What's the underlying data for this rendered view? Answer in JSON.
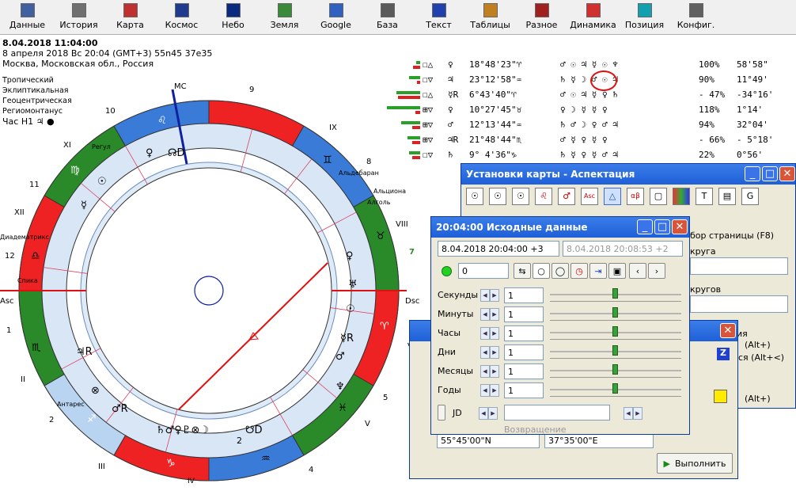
{
  "toolbar": [
    {
      "name": "data",
      "label": "Данные",
      "color": "#4060a0"
    },
    {
      "name": "history",
      "label": "История",
      "color": "#707070"
    },
    {
      "name": "map",
      "label": "Карта",
      "color": "#c03030"
    },
    {
      "name": "cosmos",
      "label": "Космос",
      "color": "#203a90"
    },
    {
      "name": "sky",
      "label": "Небо",
      "color": "#0a2a80"
    },
    {
      "name": "earth",
      "label": "Земля",
      "color": "#3a8a3a"
    },
    {
      "name": "google",
      "label": "Google",
      "color": "#3060c0"
    },
    {
      "name": "base",
      "label": "База",
      "color": "#5a5a5a"
    },
    {
      "name": "text",
      "label": "Текст",
      "color": "#2040b0"
    },
    {
      "name": "tables",
      "label": "Таблицы",
      "color": "#c08020"
    },
    {
      "name": "misc",
      "label": "Разное",
      "color": "#a02020"
    },
    {
      "name": "dynamics",
      "label": "Динамика",
      "color": "#d03030"
    },
    {
      "name": "position",
      "label": "Позиция",
      "color": "#10a0b0"
    },
    {
      "name": "config",
      "label": "Конфиг.",
      "color": "#606060"
    }
  ],
  "info": {
    "datetime": "8.04.2018 11:04:00",
    "line2": "8 апреля 2018  Вс  20:04 (GMT+3) 55n45  37e35",
    "location": "Москва, Московская обл., Россия"
  },
  "system": [
    "Тропический",
    "Эклиптикальная",
    "Геоцентрическая",
    "Региомонтанус"
  ],
  "hour": "Час Н1  ♃ ●",
  "chart": {
    "axis": {
      "mc": "MC",
      "asc": "Asc",
      "dsc": "Dsc"
    },
    "houses": [
      "1",
      "2",
      "3",
      "4",
      "5",
      "6",
      "7",
      "8",
      "9",
      "10",
      "11",
      "12"
    ],
    "houses_roman": [
      "II",
      "III",
      "IV",
      "V",
      "VI",
      "VIII",
      "IX",
      "XI",
      "XII"
    ],
    "stars": [
      "Регул",
      "Альдебаран",
      "Альциона",
      "Алголь",
      "Диадематрикс",
      "Спика",
      "Антарес"
    ],
    "signs": [
      "♌",
      "♊",
      "♉",
      "♈",
      "♓",
      "♒",
      "♑",
      "♐",
      "♏",
      "♎",
      "♍"
    ],
    "planets": [
      "♀",
      "☊D",
      "☉",
      "☿",
      "♀",
      "♅",
      "☉",
      "☿R",
      "♂",
      "♆",
      "♃R",
      "⊗",
      "♂R",
      "♄♂♀♇⊗☽",
      "☋D",
      "2"
    ]
  },
  "aspects": [
    {
      "a": "☐△",
      "p": "♀",
      "pos": "18°48'23\"♈",
      "c": "♂ ☉ ♃ ☿ ☉ ♆",
      "pct": "100%",
      "orb": "58'58\""
    },
    {
      "a": "☐▽",
      "p": "♃",
      "pos": "23°12'58\"♒",
      "c": "♄ ☿ ☽ ♂ ☉ ♃",
      "pct": "90%",
      "orb": "11°49'"
    },
    {
      "a": "☐△",
      "p": "☿R",
      "pos": "6°43'40\"♈",
      "c": "♂ ☉ ♃ ☿ ♀ ♄",
      "pct": "- 47%",
      "orb": "-34°16'"
    },
    {
      "a": "⊞▽",
      "p": "♀",
      "pos": "10°27'45\"♉",
      "c": "♀ ☽ ☿ ☿ ♀",
      "pct": "118%",
      "orb": "1°14'"
    },
    {
      "a": "⊞▽",
      "p": "♂",
      "pos": "12°13'44\"♒",
      "c": "♄ ♂ ☽ ♀ ♂ ♃",
      "pct": "94%",
      "orb": "32°04'"
    },
    {
      "a": "⊞▽",
      "p": "♃R",
      "pos": "21°48'44\"♏",
      "c": "♂ ☿ ♀ ☿ ♀",
      "pct": "- 66%",
      "orb": "- 5°18'"
    },
    {
      "a": "☐▽",
      "p": "♄",
      "pos": "9° 4'36\"♑",
      "c": "♄ ☿ ♀ ☿ ♂ ♃",
      "pct": "22%",
      "orb": "0°56'"
    }
  ],
  "aspect_window": {
    "title": "Установки карты - Аспектация",
    "labels": [
      "бор страницы (F8)",
      "круга",
      "кругов",
      "ия",
      "(Alt+)",
      "ся (Alt+<)",
      "(Alt+)",
      "ся (Alt+<)"
    ]
  },
  "data_window": {
    "title": "20:04:00 Исходные данные",
    "date_current": "8.04.2018  20:04:00  +3",
    "date_other": "8.04.2018   20:08:53  +2",
    "count": "0",
    "rows": [
      {
        "label": "Секунды",
        "value": "1",
        "level": 0.5
      },
      {
        "label": "Минуты",
        "value": "1",
        "level": 0.5
      },
      {
        "label": "Часы",
        "value": "1",
        "level": 0.5
      },
      {
        "label": "Дни",
        "value": "1",
        "level": 0.5
      },
      {
        "label": "Месяцы",
        "value": "1",
        "level": 0.5
      },
      {
        "label": "Годы",
        "value": "1",
        "level": 0.5
      }
    ],
    "jd": "JD",
    "return": "Возвращение"
  },
  "third_window": {
    "lat": "55°45'00\"N",
    "lon": "37°35'00\"E",
    "exec": "Выполнить",
    "z": "Z"
  }
}
